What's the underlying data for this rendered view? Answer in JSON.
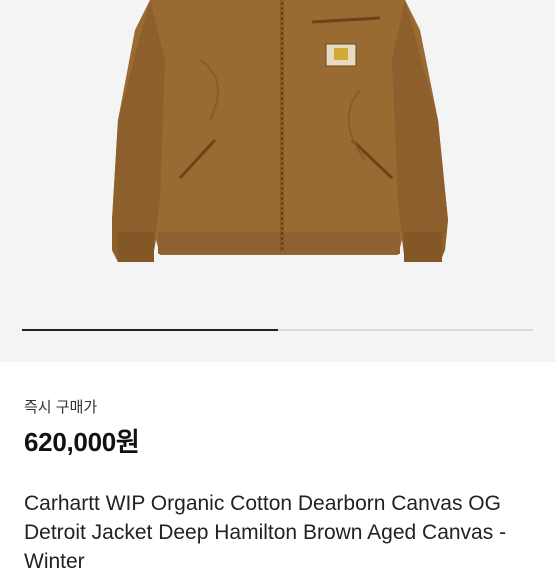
{
  "product_image": {
    "icon": "jacket-photo",
    "label_badge": "carhartt-logo-label",
    "colors": {
      "jacket": "#9a6a33",
      "jacket_dark": "#7c5224",
      "background": "#f4f4f4"
    }
  },
  "carousel": {
    "current_fraction": 0.5
  },
  "purchase": {
    "label": "즉시 구매가",
    "price": "620,000원"
  },
  "product": {
    "title": "Carhartt WIP Organic Cotton Dearborn Canvas OG Detroit Jacket Deep Hamilton Brown Aged Canvas - Winter"
  }
}
